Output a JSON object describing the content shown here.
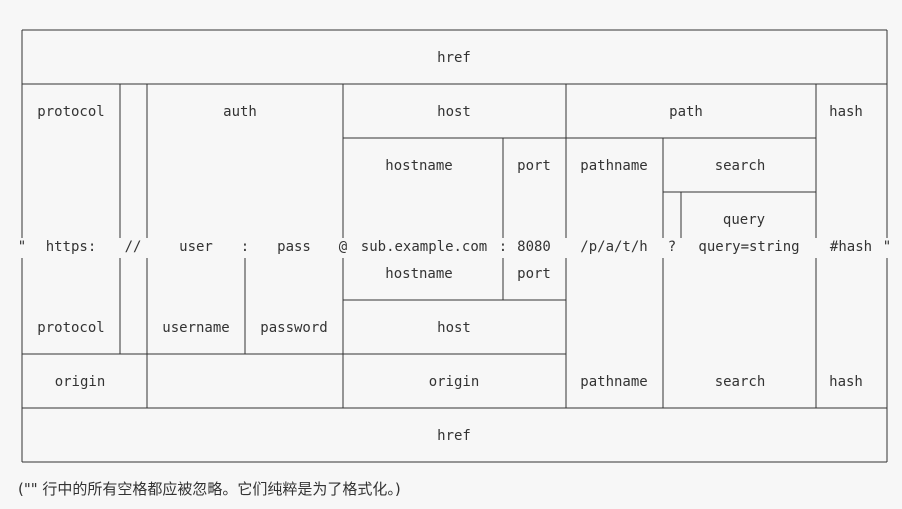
{
  "top_href": "href",
  "row_breakdown": {
    "protocol": "protocol",
    "auth": "auth",
    "host": "host",
    "path": "path",
    "hash": "hash",
    "hostname": "hostname",
    "port": "port",
    "pathname": "pathname",
    "search": "search",
    "query": "query"
  },
  "url_line": {
    "open_quote": "\"",
    "scheme": "https:",
    "slashes": "//",
    "user": "user",
    "colon": ":",
    "pass": "pass",
    "at": "@",
    "hostname": "sub.example.com",
    "port_colon": ":",
    "port": "8080",
    "pathname": "/p/a/t/h",
    "question": "?",
    "query": "query=string",
    "hash": "#hash",
    "close_quote": "\""
  },
  "lower_breakdown": {
    "hostname": "hostname",
    "port": "port",
    "protocol": "protocol",
    "username": "username",
    "password": "password",
    "host": "host",
    "origin_left": "origin",
    "origin_right": "origin",
    "pathname": "pathname",
    "search": "search",
    "hash": "hash"
  },
  "bottom_href": "href",
  "footnote": "(\"\" 行中的所有空格都应被忽略。它们纯粹是为了格式化。)"
}
